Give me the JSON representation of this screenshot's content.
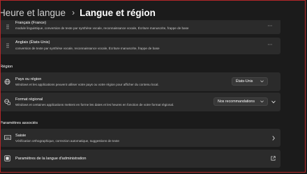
{
  "header": {
    "parent": "Heure et langue",
    "separator": "›",
    "current": "Langue et région"
  },
  "languages": [
    {
      "name": "Français (France)",
      "features": "module linguistique, conversion de texte par synthèse vocale, reconnaissance vocale, Écriture manuscrite, frappe de base"
    },
    {
      "name": "Anglais (États-Unis)",
      "features": "conversion de texte par synthèse vocale, reconnaissance vocale, Écriture manuscrite, frappe de base"
    }
  ],
  "region": {
    "label": "Région",
    "country": {
      "title": "Pays ou région",
      "desc": "Windows et les applications peuvent utiliser votre pays ou votre région pour afficher du contenu local.",
      "value": "États-Unis"
    },
    "format": {
      "title": "Format régional",
      "desc": "Windows et certaines applications mettent en forme les dates et les heures en fonction de votre format régional.",
      "value": "Nos recommandations"
    }
  },
  "related": {
    "label": "Paramètres associés",
    "typing": {
      "title": "Saisie",
      "desc": "Vérification orthographique, correction automatique, suggestions de texte"
    },
    "admin": {
      "title": "Paramètres de la langue d'administration"
    }
  },
  "icons": {
    "more": "⋯"
  }
}
